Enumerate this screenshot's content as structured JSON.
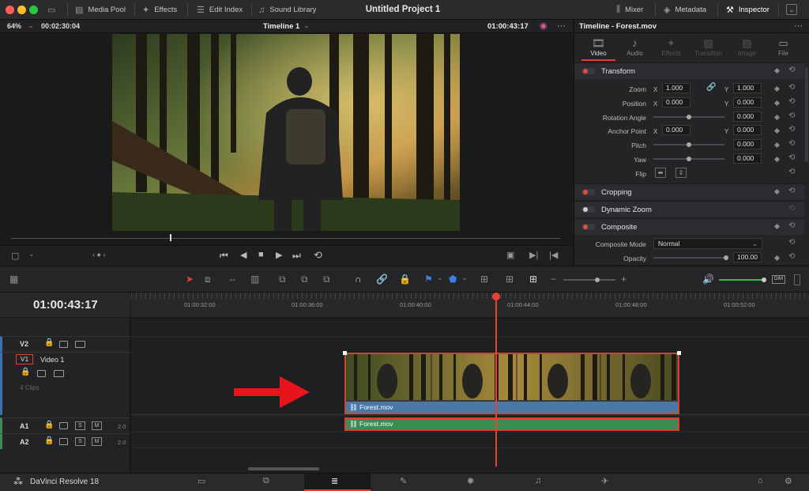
{
  "window": {
    "title": "Untitled Project 1",
    "controls": [
      "#ff5f57",
      "#febc2e",
      "#28c840"
    ]
  },
  "topbar": {
    "media_pool": "Media Pool",
    "effects": "Effects",
    "edit_index": "Edit Index",
    "sound_library": "Sound Library",
    "mixer": "Mixer",
    "metadata": "Metadata",
    "inspector": "Inspector"
  },
  "viewer": {
    "zoom": "64%",
    "duration": "00:02:30:04",
    "timeline_name": "Timeline 1",
    "timecode": "01:00:43:17"
  },
  "inspector": {
    "title": "Timeline - Forest.mov",
    "tabs": [
      "Video",
      "Audio",
      "Effects",
      "Transition",
      "Image",
      "File"
    ],
    "active_tab": "Video",
    "transform": {
      "title": "Transform",
      "zoom_label": "Zoom",
      "zoom_x": "1.000",
      "zoom_y": "1.000",
      "position_label": "Position",
      "position_x": "0.000",
      "position_y": "0.000",
      "rotation_label": "Rotation Angle",
      "rotation": "0.000",
      "anchor_label": "Anchor Point",
      "anchor_x": "0.000",
      "anchor_y": "0.000",
      "pitch_label": "Pitch",
      "pitch": "0.000",
      "yaw_label": "Yaw",
      "yaw": "0.000",
      "flip_label": "Flip",
      "x_label": "X",
      "y_label": "Y"
    },
    "cropping": "Cropping",
    "dynamic_zoom": "Dynamic Zoom",
    "composite": {
      "title": "Composite",
      "mode_label": "Composite Mode",
      "mode_value": "Normal",
      "opacity_label": "Opacity",
      "opacity": "100.00"
    }
  },
  "timeline": {
    "timecode": "01:00:43:17",
    "ruler": [
      "01:00:32:00",
      "01:00:36:00",
      "01:00:40:00",
      "01:00:44:00",
      "01:00:48:00",
      "01:00:52:00"
    ],
    "tracks": {
      "v2": "V2",
      "v1": "V1",
      "v1_name": "Video 1",
      "v1_clips": "4 Clips",
      "a1": "A1",
      "a2": "A2",
      "a1_level": "2.0",
      "a2_level": "2.0",
      "solo": "S",
      "mute": "M"
    },
    "video_clip": "Forest.mov",
    "audio_clip": "Forest.mov"
  },
  "bottombar": {
    "app_name": "DaVinci Resolve 18"
  },
  "colors": {
    "accent_red": "#e0402f",
    "playhead": "#e8432f",
    "video_clip": "#4a79a8",
    "audio_clip": "#3f8a55",
    "audio_level": "#2fbf4a"
  }
}
